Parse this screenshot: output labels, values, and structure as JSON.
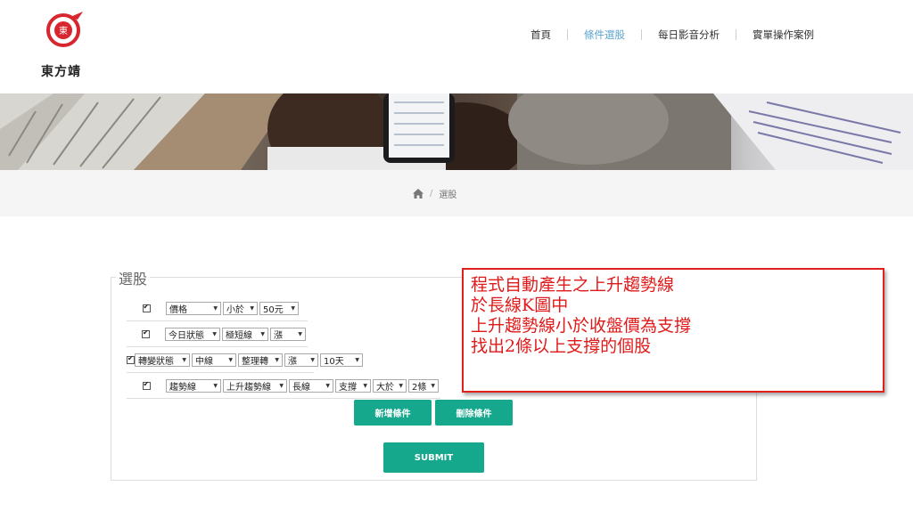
{
  "brand": {
    "name": "東方靖",
    "logo_char": "東",
    "color": "#d7262e"
  },
  "nav": [
    {
      "label": "首頁",
      "active": false
    },
    {
      "label": "條件選股",
      "active": true
    },
    {
      "label": "每日影音分析",
      "active": false
    },
    {
      "label": "實單操作案例",
      "active": false
    }
  ],
  "breadcrumb": {
    "home_icon": "home-icon",
    "current": "選股"
  },
  "form": {
    "legend": "選股",
    "rows": [
      {
        "checked": true,
        "selects": [
          "價格",
          "小於",
          "50元"
        ]
      },
      {
        "checked": true,
        "selects": [
          "今日狀態",
          "極短線",
          "漲"
        ]
      },
      {
        "checked": true,
        "selects": [
          "轉變狀態",
          "中線",
          "整理轉",
          "漲",
          "10天"
        ]
      },
      {
        "checked": true,
        "selects": [
          "趨勢線",
          "上升趨勢線",
          "長線",
          "支撐",
          "大於",
          "2條"
        ]
      }
    ],
    "add_label": "新增條件",
    "remove_label": "刪除條件",
    "submit_label": "SUBMIT"
  },
  "annotation": {
    "lines": [
      "程式自動產生之上升趨勢線",
      "於長線K圖中",
      "上升趨勢線小於收盤價為支撐",
      "找出2條以上支撐的個股"
    ]
  },
  "colors": {
    "accent": "#16a88d",
    "nav_active": "#5ba4cf",
    "annotation": "#e01a1a"
  }
}
